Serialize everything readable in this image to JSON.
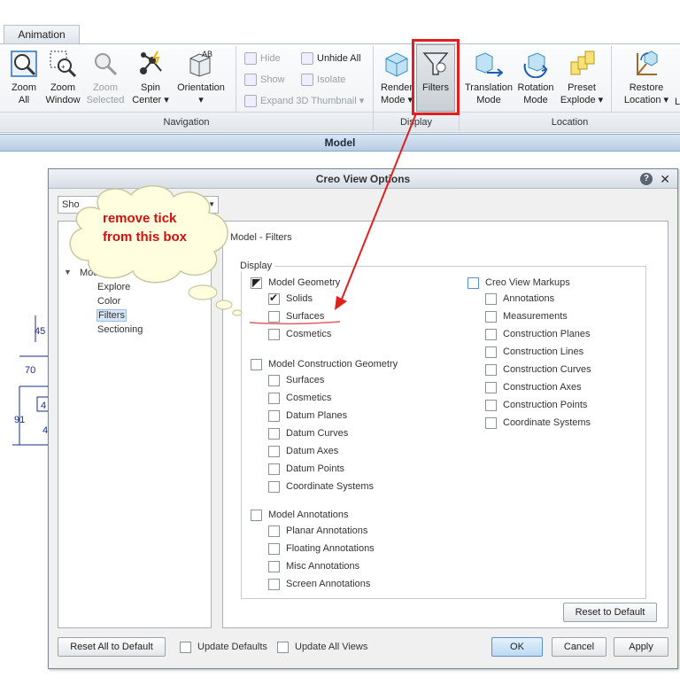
{
  "ribbon": {
    "tab_label": "Animation",
    "buttons": {
      "zoom_all": "Zoom\nAll",
      "zoom_window": "Zoom\nWindow",
      "zoom_selected": "Zoom\nSelected",
      "spin_center": "Spin\nCenter ▾",
      "orientation": "Orientation\n▾",
      "hide": "Hide",
      "unhide_all": "Unhide All",
      "show": "Show",
      "isolate": "Isolate",
      "expand_3d_thumbnail": "Expand 3D Thumbnail ▾",
      "render_mode": "Render\nMode ▾",
      "filters": "Filters",
      "translation_mode": "Translation\nMode",
      "rotation_mode": "Rotation\nMode",
      "preset_explode": "Preset\nExplode ▾",
      "restore_location": "Restore\nLocation ▾",
      "cut_l": "L"
    },
    "groups": {
      "navigation": "Navigation",
      "display": "Display",
      "location": "Location"
    }
  },
  "model_bar": "Model",
  "drawing": {
    "dim_45": "45",
    "dim_70": "70",
    "dim_91": "91",
    "dim_4a": "4",
    "dim_4b": "4"
  },
  "dialog": {
    "title": "Creo View Options",
    "help": "?",
    "close": "✕",
    "show_label": "Sho",
    "tree": {
      "model": "Model",
      "explore": "Explore",
      "color": "Color",
      "filters": "Filters",
      "sectioning": "Sectioning"
    },
    "panel_title": "Model - Filters",
    "legend": "Display",
    "left_groups": [
      {
        "label": "Model Geometry",
        "state": "partial",
        "items": [
          {
            "label": "Solids",
            "state": "checked"
          },
          {
            "label": "Surfaces",
            "state": "unchecked"
          },
          {
            "label": "Cosmetics",
            "state": "unchecked"
          }
        ]
      },
      {
        "label": "Model Construction Geometry",
        "state": "unchecked",
        "items": [
          {
            "label": "Surfaces",
            "state": "unchecked"
          },
          {
            "label": "Cosmetics",
            "state": "unchecked"
          },
          {
            "label": "Datum Planes",
            "state": "unchecked"
          },
          {
            "label": "Datum Curves",
            "state": "unchecked"
          },
          {
            "label": "Datum Axes",
            "state": "unchecked"
          },
          {
            "label": "Datum Points",
            "state": "unchecked"
          },
          {
            "label": "Coordinate Systems",
            "state": "unchecked"
          }
        ]
      },
      {
        "label": "Model Annotations",
        "state": "unchecked",
        "items": [
          {
            "label": "Planar Annotations",
            "state": "unchecked"
          },
          {
            "label": "Floating Annotations",
            "state": "unchecked"
          },
          {
            "label": "Misc Annotations",
            "state": "unchecked"
          },
          {
            "label": "Screen Annotations",
            "state": "unchecked"
          }
        ]
      }
    ],
    "right_group": {
      "label": "Creo View Markups",
      "state": "unchecked",
      "items": [
        {
          "label": "Annotations"
        },
        {
          "label": "Measurements"
        },
        {
          "label": "Construction Planes"
        },
        {
          "label": "Construction Lines"
        },
        {
          "label": "Construction Curves"
        },
        {
          "label": "Construction Axes"
        },
        {
          "label": "Construction Points"
        },
        {
          "label": "Coordinate Systems"
        }
      ]
    },
    "reset_to_default": "Reset to Default",
    "reset_all_to_default": "Reset All to Default",
    "update_defaults": "Update Defaults",
    "update_all_views": "Update All Views",
    "ok": "OK",
    "cancel": "Cancel",
    "apply": "Apply"
  },
  "callout": {
    "line1": "remove tick",
    "line2": "from this box"
  },
  "colors": {
    "annotation_red": "#e02020",
    "callout_text": "#d01010",
    "cloud_fill": "#ffffe0"
  }
}
